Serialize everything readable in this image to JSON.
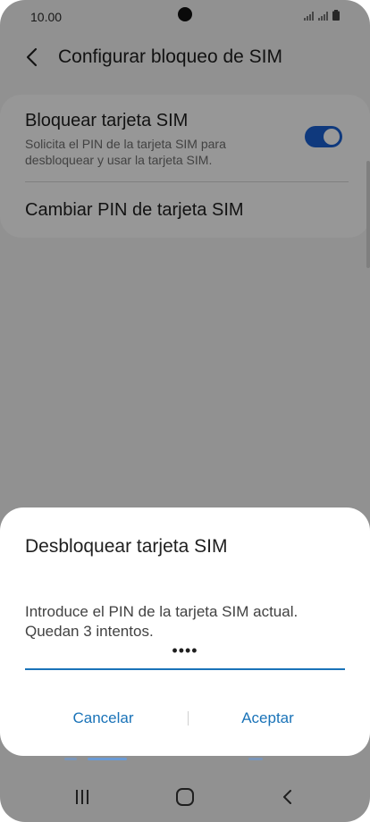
{
  "status_bar": {
    "time": "10.00"
  },
  "header": {
    "title": "Configurar bloqueo de SIM",
    "back_icon": "chevron-left-icon"
  },
  "settings": {
    "lock_sim": {
      "title": "Bloquear tarjeta SIM",
      "description": "Solicita el PIN de la tarjeta SIM para desbloquear y usar la tarjeta SIM.",
      "enabled": true
    },
    "change_pin": {
      "label": "Cambiar PIN de tarjeta SIM"
    }
  },
  "dialog": {
    "title": "Desbloquear tarjeta SIM",
    "message": "Introduce el PIN de la tarjeta SIM actual. Quedan 3 intentos.",
    "pin_value": "••••",
    "cancel_label": "Cancelar",
    "accept_label": "Aceptar"
  },
  "nav_bar": {
    "recent_icon": "recent-apps-icon",
    "home_icon": "home-icon",
    "back_icon": "back-icon"
  },
  "colors": {
    "accent": "#1a73b8",
    "toggle_on": "#1a5fd0"
  }
}
